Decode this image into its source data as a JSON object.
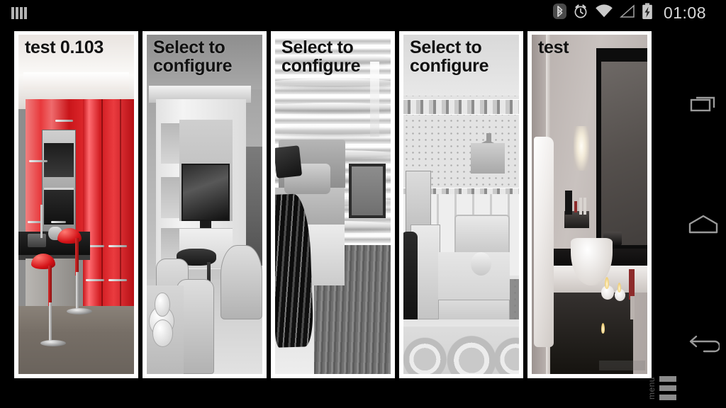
{
  "status_bar": {
    "notification_icon": "notification-bars-icon",
    "icons": [
      {
        "name": "bluetooth-icon",
        "label": "Bluetooth"
      },
      {
        "name": "alarm-icon",
        "label": "Alarm set"
      },
      {
        "name": "wifi-icon",
        "label": "Wi-Fi connected"
      },
      {
        "name": "cellular-signal-icon",
        "label": "Cellular signal"
      },
      {
        "name": "battery-charging-icon",
        "label": "Battery charging"
      }
    ],
    "time": "01:08",
    "background": "#000000",
    "text_color": "#d8d8d8"
  },
  "cards": [
    {
      "id": "card-1",
      "label": "test 0.103",
      "scene": "red-kitchen",
      "photo_description": "Red gloss kitchen with oven column, black countertop and red bar stools"
    },
    {
      "id": "card-2",
      "label": "Select to\nconfigure",
      "scene": "living-room",
      "photo_description": "Grayscale living room with built-in TV wall unit, dining chairs and table setting"
    },
    {
      "id": "card-3",
      "label": "Select to\nconfigure",
      "scene": "bedroom-wave-wall",
      "photo_description": "Bedroom with 3D wavy wall panel, bed with dark throw and shag rug"
    },
    {
      "id": "card-4",
      "label": "Select to\nconfigure",
      "scene": "kids-room",
      "photo_description": "Child's bedroom with dotted wallpaper border, wall shelf, desk chair, single bed and circle rug"
    },
    {
      "id": "card-5",
      "label": "test",
      "scene": "bathroom",
      "photo_description": "Bathroom with vessel sink, black framed mirror, wall sconce, white towel and candles"
    }
  ],
  "nav_bar": {
    "buttons": [
      {
        "name": "recent-apps-button",
        "label": "Recent apps"
      },
      {
        "name": "home-button",
        "label": "Home"
      },
      {
        "name": "back-button",
        "label": "Back"
      }
    ],
    "icon_color": "#9a9a9a"
  },
  "menu_button": {
    "label": "menu",
    "icon": "hamburger-menu-icon",
    "label_color": "#5a5a5a",
    "bar_color": "#8c8c8c"
  },
  "colors": {
    "background": "#000000",
    "card_frame": "#ffffff",
    "card_label_text": "#111111",
    "accent_red": "#d41318"
  }
}
